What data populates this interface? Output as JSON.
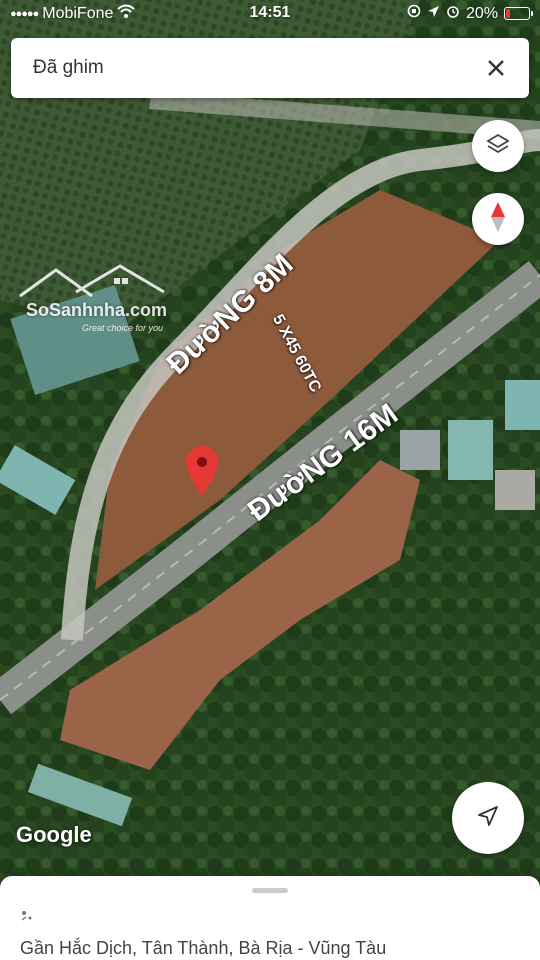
{
  "status_bar": {
    "carrier": "MobiFone",
    "time": "14:51",
    "battery": "20%",
    "battery_level": 0.2,
    "battery_color": "#e53935"
  },
  "search": {
    "text": "Đã ghim",
    "close_icon": "close-icon"
  },
  "controls": {
    "layers_icon": "layers-icon",
    "compass_icon": "compass-icon",
    "locate_icon": "navigation-arrow-icon",
    "compass_color": "#e53935"
  },
  "map": {
    "attribution": "Google",
    "watermark_brand": "SoSanhnha.com",
    "watermark_tag": "Great choice for you",
    "labels": {
      "road_8m": "ĐườNG 8M",
      "dimensions": "5 X45 60TC",
      "road_16m": "ĐườNG 16M"
    },
    "pin_color": "#e53935"
  },
  "place": {
    "address": "Gần Hắc Dịch, Tân Thành, Bà Rịa - Vũng Tàu"
  }
}
